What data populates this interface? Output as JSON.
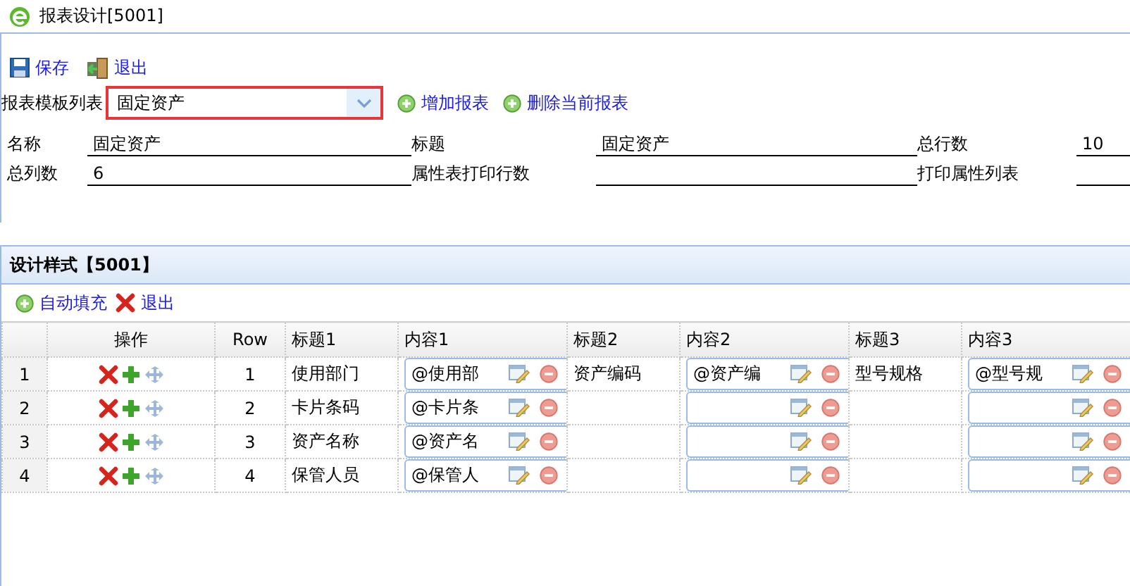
{
  "window": {
    "title": "报表设计[5001]"
  },
  "toolbar": [
    {
      "kind": "save",
      "label": "保存"
    },
    {
      "kind": "exit",
      "label": "退出"
    }
  ],
  "template": {
    "label": "报表模板列表",
    "value": "固定资产",
    "actions": [
      {
        "label": "增加报表"
      },
      {
        "label": "删除当前报表"
      }
    ]
  },
  "form": [
    {
      "label": "名称",
      "value": "固定资产"
    },
    {
      "label": "标题",
      "value": "固定资产"
    },
    {
      "label": "总行数",
      "value": "10"
    },
    {
      "label": "总列数",
      "value": "6"
    },
    {
      "label": "属性表打印行数"
    },
    {
      "label": "打印属性列表"
    }
  ],
  "panel": {
    "title": "设计样式【5001】",
    "toolbar": [
      {
        "kind": "add",
        "label": "自动填充"
      },
      {
        "kind": "delete",
        "label": "退出"
      }
    ]
  },
  "table": {
    "columns": [
      "",
      "操作",
      "Row",
      "标题1",
      "内容1",
      "标题2",
      "内容2",
      "标题3",
      "内容3"
    ],
    "rows": [
      {
        "cells": [
          "1",
          "",
          "1",
          "使用部门",
          "@使用部",
          "资产编码",
          "@资产编",
          "型号规格",
          "@型号规"
        ]
      },
      {
        "cells": [
          "2",
          "",
          "2",
          "卡片条码",
          "@卡片条",
          "",
          "",
          "",
          ""
        ]
      },
      {
        "cells": [
          "3",
          "",
          "3",
          "资产名称",
          "@资产名",
          "",
          "",
          "",
          ""
        ]
      },
      {
        "cells": [
          "4",
          "",
          "4",
          "保管人员",
          "@保管人",
          "",
          "",
          "",
          ""
        ]
      }
    ]
  }
}
